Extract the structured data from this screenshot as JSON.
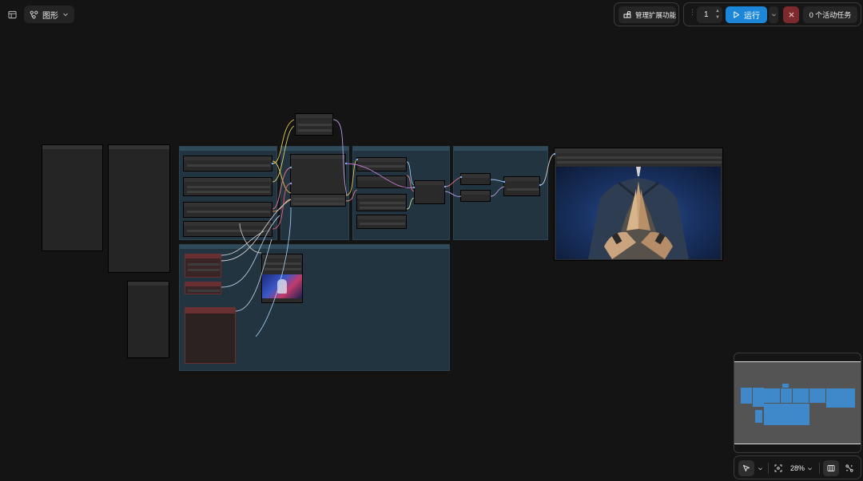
{
  "toolbar": {
    "graph_tab_label": "图形",
    "manage_extensions_label": "管理扩展功能",
    "queue_count": "1",
    "run_label": "运行",
    "active_tasks_label": "0 个活动任务"
  },
  "canvas": {
    "zoom_level": "28%"
  },
  "colors": {
    "accent": "#1c86d9",
    "stop": "#7d2a2e",
    "group": "#223440",
    "node": "#2a2a2a"
  },
  "icons": [
    "panel-icon",
    "workflow-icon",
    "chevron-down-icon",
    "extensions-icon",
    "play-icon",
    "close-icon",
    "pointer-icon",
    "fit-view-icon",
    "minimap-icon",
    "link-icon"
  ]
}
